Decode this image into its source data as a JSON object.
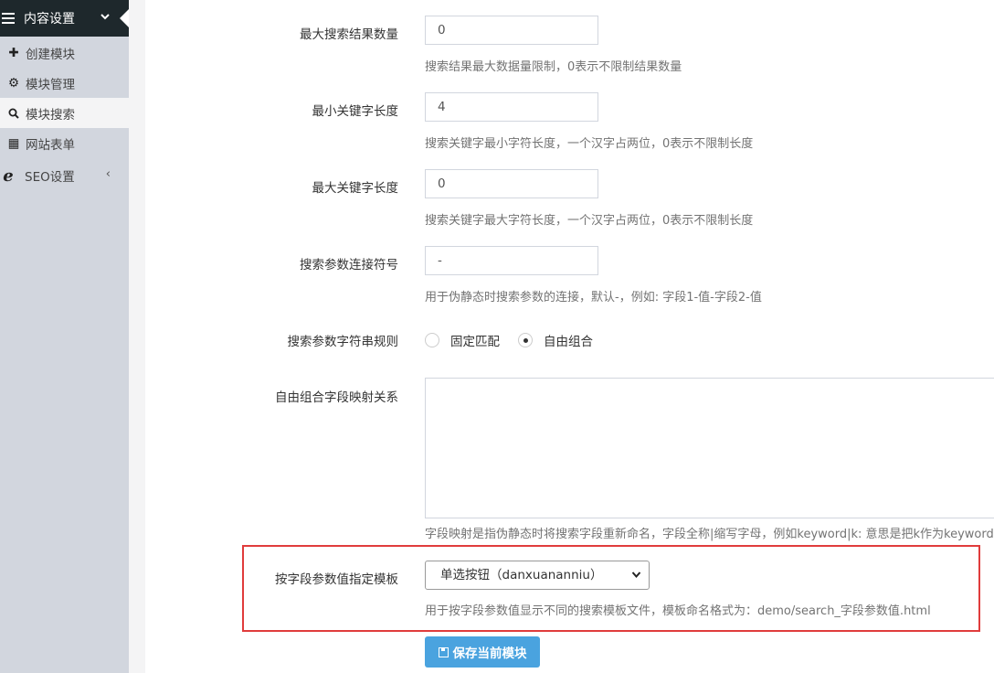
{
  "sidebar": {
    "header": {
      "label": "内容设置",
      "icon": "menu-icon",
      "chevron": "chevron-down-icon"
    },
    "items": [
      {
        "label": "创建模块",
        "icon": "plus-icon",
        "glyph": "✚"
      },
      {
        "label": "模块管理",
        "icon": "cogs-icon",
        "glyph": "⚙"
      },
      {
        "label": "模块搜索",
        "icon": "search-icon",
        "glyph": "⌕",
        "active": true
      },
      {
        "label": "网站表单",
        "icon": "table-icon",
        "glyph": "▦"
      }
    ],
    "seo": {
      "label": "SEO设置",
      "icon": "ie-icon",
      "glyph": "e",
      "chevron": "‹"
    }
  },
  "form": {
    "max_results": {
      "label": "最大搜索结果数量",
      "value": "0",
      "help": "搜索结果最大数据量限制，0表示不限制结果数量"
    },
    "min_keyword": {
      "label": "最小关键字长度",
      "value": "4",
      "help": "搜索关键字最小字符长度，一个汉字占两位，0表示不限制长度"
    },
    "max_keyword": {
      "label": "最大关键字长度",
      "value": "0",
      "help": "搜索关键字最大字符长度，一个汉字占两位，0表示不限制长度"
    },
    "separator": {
      "label": "搜索参数连接符号",
      "value": "-",
      "help": "用于伪静态时搜索参数的连接，默认-，例如: 字段1-值-字段2-值"
    },
    "param_rule": {
      "label": "搜索参数字符串规则",
      "options": [
        {
          "label": "固定匹配",
          "checked": false
        },
        {
          "label": "自由组合",
          "checked": true
        }
      ]
    },
    "field_mapping": {
      "label": "自由组合字段映射关系",
      "value": "",
      "help": "字段映射是指伪静态时将搜索字段重新命名，字段全称|缩写字母，例如keyword|k: 意思是把k作为keyword"
    },
    "template_field": {
      "label": "按字段参数值指定模板",
      "selected": "单选按钮（danxuananniu）",
      "help": "用于按字段参数值显示不同的搜索模板文件，模板命名格式为：demo/search_字段参数值.html"
    },
    "save_button": "保存当前模块"
  },
  "colors": {
    "sidebar_bg": "#d2d6de",
    "sidebar_header_bg": "#1e282c",
    "highlight_border": "#e03c3c",
    "button_bg": "#4aa3df"
  }
}
